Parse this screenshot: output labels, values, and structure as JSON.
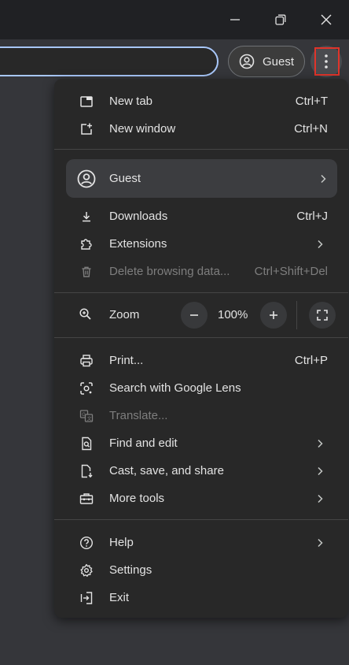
{
  "window": {
    "minimize_icon": "minimize-icon",
    "restore_icon": "restore-icon",
    "close_icon": "close-icon"
  },
  "toolbar": {
    "profile_label": "Guest"
  },
  "menu": {
    "new_tab": {
      "label": "New tab",
      "shortcut": "Ctrl+T"
    },
    "new_window": {
      "label": "New window",
      "shortcut": "Ctrl+N"
    },
    "profile": {
      "label": "Guest"
    },
    "downloads": {
      "label": "Downloads",
      "shortcut": "Ctrl+J"
    },
    "extensions": {
      "label": "Extensions"
    },
    "delete_data": {
      "label": "Delete browsing data...",
      "shortcut": "Ctrl+Shift+Del"
    },
    "zoom": {
      "label": "Zoom",
      "value": "100%",
      "minus": "−",
      "plus": "+"
    },
    "print": {
      "label": "Print...",
      "shortcut": "Ctrl+P"
    },
    "lens": {
      "label": "Search with Google Lens"
    },
    "translate": {
      "label": "Translate..."
    },
    "find_edit": {
      "label": "Find and edit"
    },
    "cast_save": {
      "label": "Cast, save, and share"
    },
    "more_tools": {
      "label": "More tools"
    },
    "help": {
      "label": "Help"
    },
    "settings": {
      "label": "Settings"
    },
    "exit": {
      "label": "Exit"
    }
  },
  "colors": {
    "frame": "#202124",
    "toolbar": "#35363a",
    "menu_bg": "#282828",
    "omnibox_focus": "#a8c7fa",
    "highlight": "#e0342a"
  }
}
